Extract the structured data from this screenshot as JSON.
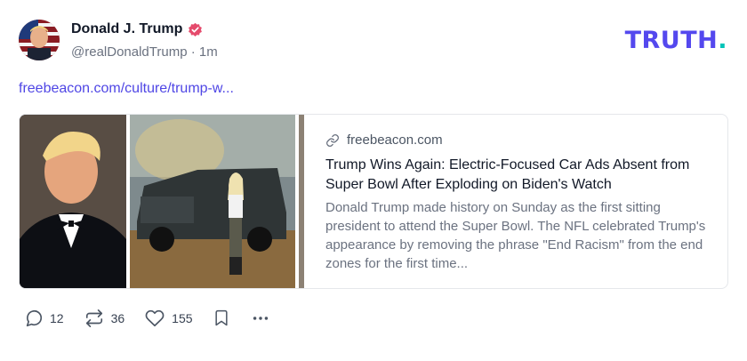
{
  "post": {
    "display_name": "Donald J. Trump",
    "handle": "@realDonaldTrump",
    "separator": "·",
    "time": "1m",
    "link": "freebeacon.com/culture/trump-w..."
  },
  "brand": {
    "logo": "TRUTH",
    "logo_dot": "."
  },
  "card": {
    "source": "freebeacon.com",
    "title": "Trump Wins Again: Electric-Focused Car Ads Absent from Super Bowl After Exploding on Biden's Watch",
    "description": "Donald Trump made history on Sunday as the first sitting president to attend the Super Bowl. The NFL celebrated Trump's appearance by removing the phrase \"End Racism\" from the end zones for the first time..."
  },
  "actions": {
    "replies": "12",
    "reposts": "36",
    "likes": "155"
  },
  "colors": {
    "brand_purple": "#5448ee",
    "brand_teal": "#00c4b8",
    "verified": "#e54b6c",
    "link": "#4f46e5"
  },
  "icons": [
    "verified-badge-icon",
    "link-icon",
    "reply-icon",
    "repost-icon",
    "like-icon",
    "bookmark-icon",
    "more-icon"
  ]
}
